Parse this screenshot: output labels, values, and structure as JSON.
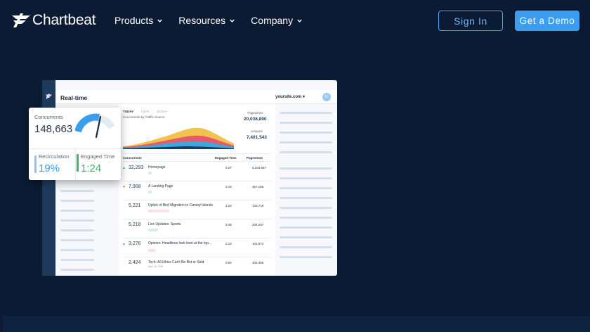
{
  "nav": {
    "logo_text": "Chartbeat",
    "menu": [
      {
        "label": "Products"
      },
      {
        "label": "Resources"
      },
      {
        "label": "Company"
      }
    ],
    "sign_in": "Sign In",
    "get_demo": "Get a Demo"
  },
  "colors": {
    "background": "#0b1b33",
    "accent": "#3a9df0",
    "sidebar": "#1d3a5c"
  },
  "mock": {
    "title": "Real-time",
    "site": "yoursite.com ▾",
    "avatar": "U",
    "tabs": [
      {
        "label": "TODAY",
        "active": true
      },
      {
        "label": "7 DAY",
        "active": false
      },
      {
        "label": "30 DAY",
        "active": false
      }
    ],
    "chart_caption": "Concurrents by Traffic Source",
    "pageviews_label": "Pageviews",
    "pageviews_value": "20,036,890",
    "uniques_label": "Uniques",
    "uniques_value": "7,401,543",
    "headers": {
      "concurrents": "Concurrents",
      "engaged_time": "Engaged Time",
      "pageviews": "Pageviews"
    },
    "rows": [
      {
        "arrow": "▲",
        "concurrents": "32,293",
        "page": "Homepage",
        "sub": "",
        "engaged": "0:27",
        "pageviews": "6,234,567"
      },
      {
        "arrow": "▼",
        "concurrents": "7,908",
        "page": "A Landing Page",
        "sub": "",
        "engaged": "3:19",
        "pageviews": "357,166"
      },
      {
        "arrow": "",
        "concurrents": "5,221",
        "page": "Uptick of Bird Migration to Canary Islands",
        "sub": "",
        "engaged": "1:23",
        "pageviews": "133,718"
      },
      {
        "arrow": "",
        "concurrents": "5,218",
        "page": "Live Updates: Sports",
        "sub": "",
        "engaged": "0:45",
        "pageviews": "204,007"
      },
      {
        "arrow": "▲",
        "concurrents": "3,276",
        "page": "Opinion: Headlines look best at the top...",
        "sub": "",
        "engaged": "2:13",
        "pageviews": "102,672"
      },
      {
        "arrow": "",
        "concurrents": "2,424",
        "page": "Tech: AI Ethics Can't Be Bot or Sold",
        "sub": "April 19, 2021",
        "engaged": "0:54",
        "pageviews": "402,355"
      }
    ]
  },
  "card": {
    "concurrents_label": "Concurrents",
    "concurrents_value": "148,663",
    "recirculation_label": "Recirculation",
    "recirculation_value": "19%",
    "engaged_label": "Engaged Time",
    "engaged_value": "1:24"
  }
}
